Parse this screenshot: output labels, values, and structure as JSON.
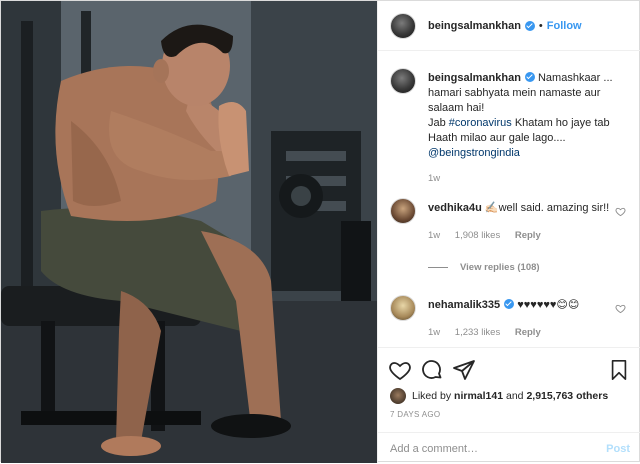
{
  "post": {
    "author": "beingsalmankhan",
    "follow_label": "Follow",
    "dot": "•"
  },
  "caption": {
    "user": "beingsalmankhan",
    "text_line1": "Namashkaar ... hamari sabhyata mein namaste aur salaam hai!",
    "text_line2_prefix": "Jab ",
    "hashtag": "#coronavirus",
    "text_line2_suffix": " Khatam ho jaye tab Haath milao aur gale lago....",
    "mention": "@beingstrongindia",
    "time": "1w"
  },
  "comments": [
    {
      "user": "vedhika4u",
      "text": "✍🏻well said. amazing sir!!",
      "time": "1w",
      "likes": "1,908 likes",
      "reply_label": "Reply"
    },
    {
      "user": "nehamalik335",
      "text": "♥♥♥♥♥♥😊😊",
      "time": "1w",
      "likes": "1,233 likes",
      "reply_label": "Reply"
    }
  ],
  "view_replies": "View replies (108)",
  "likes_summary": {
    "prefix": "Liked by ",
    "user": "nirmal141",
    "middle": " and ",
    "count": "2,915,763 others"
  },
  "date": "7 DAYS AGO",
  "add_comment": {
    "placeholder": "Add a comment…",
    "post_label": "Post"
  },
  "icons": {
    "like": "heart-icon",
    "comment": "comment-icon",
    "share": "share-icon",
    "save": "bookmark-icon"
  },
  "colors": {
    "link": "#3897f0",
    "tag": "#00376b",
    "muted": "#8e8e8e",
    "post_disabled": "#b2dffc"
  }
}
